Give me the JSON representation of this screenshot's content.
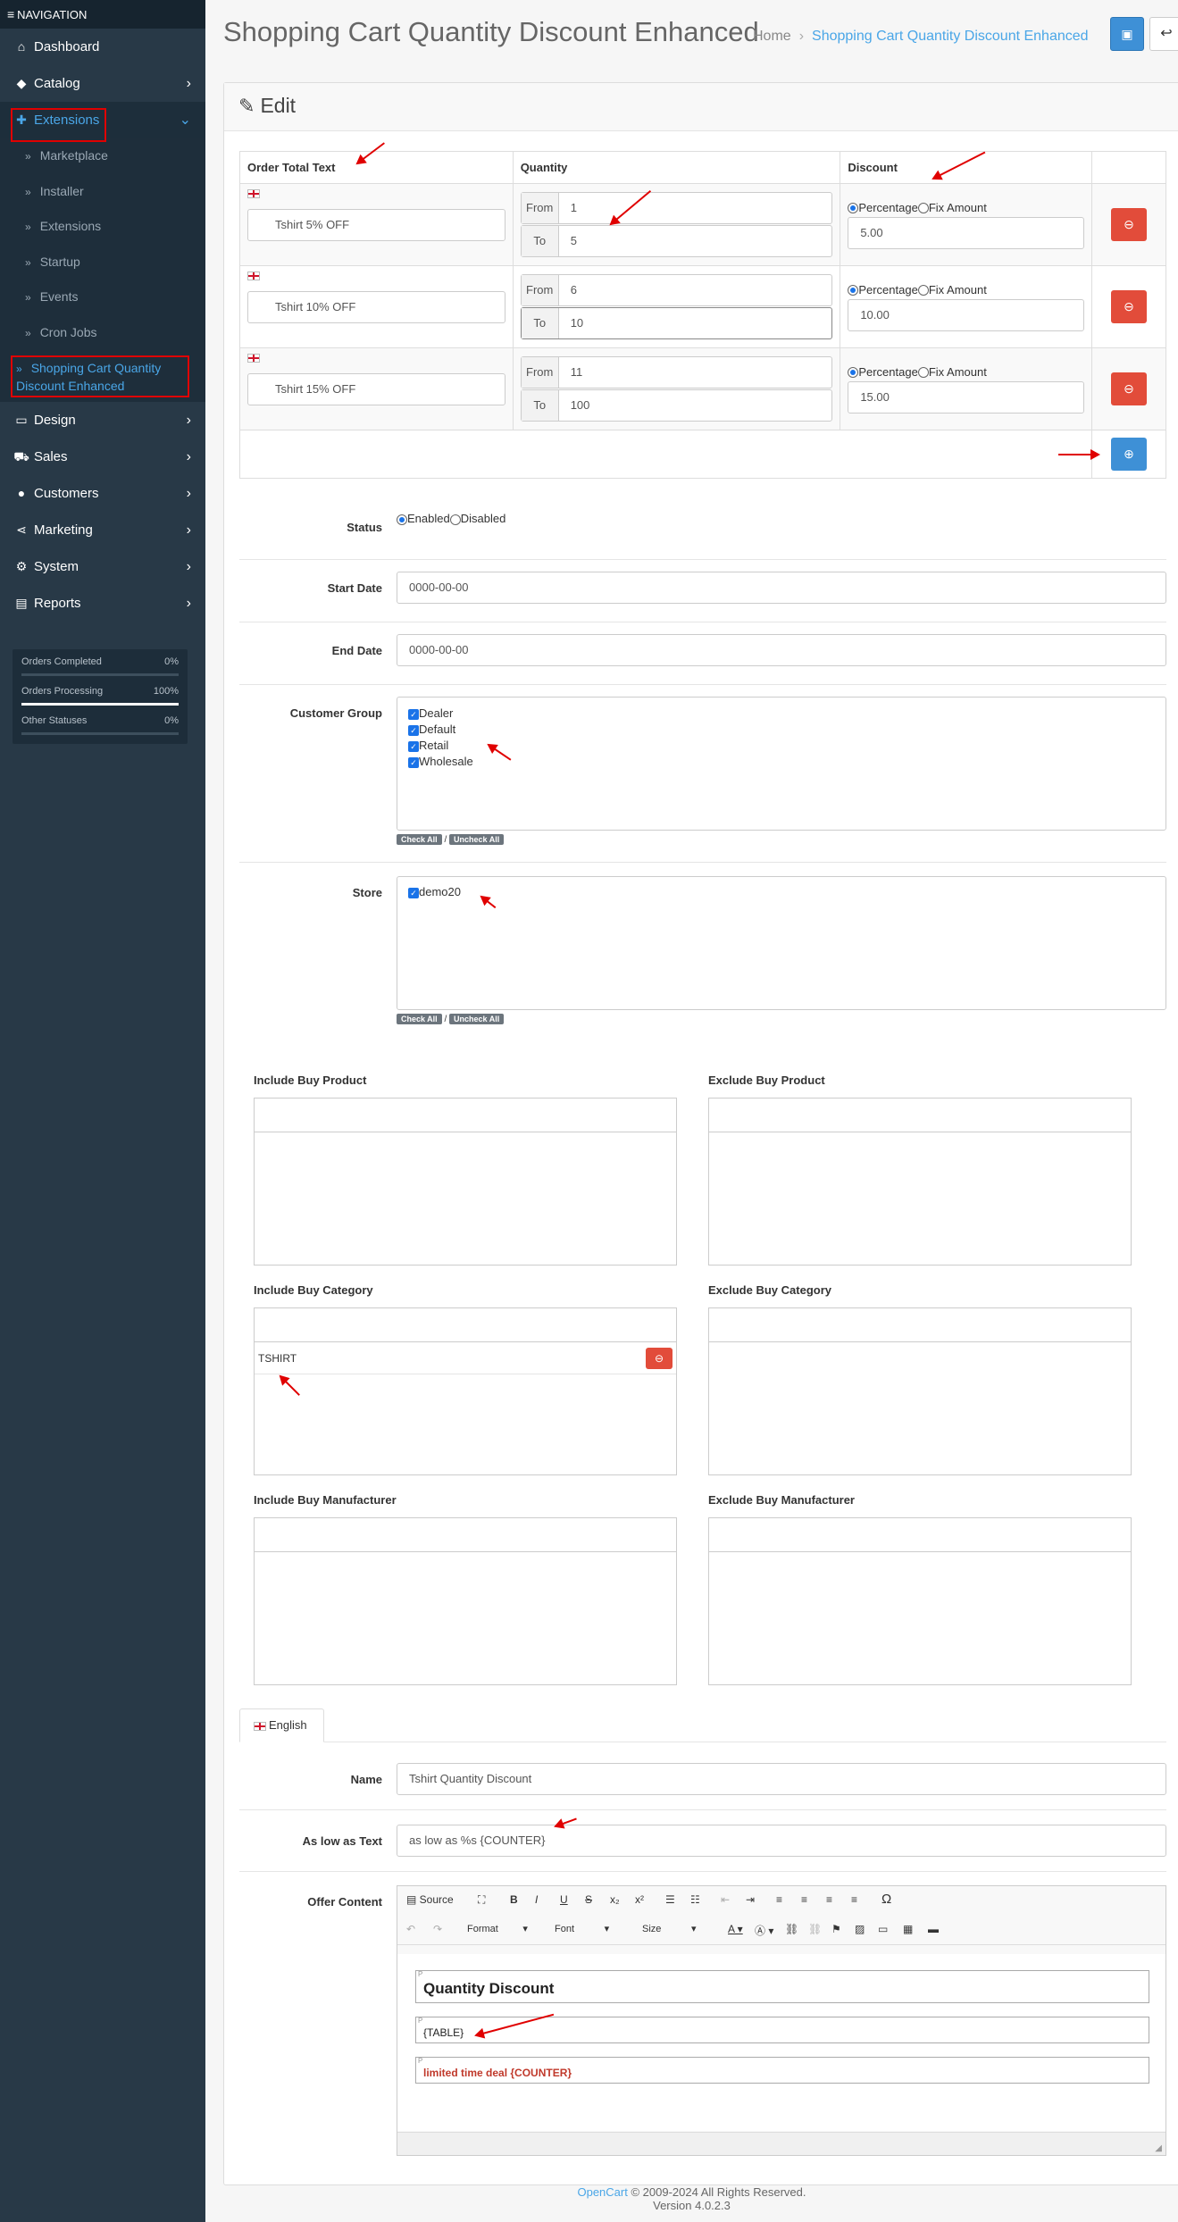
{
  "nav": {
    "header": "NAVIGATION",
    "items": [
      {
        "label": "Dashboard",
        "icon": "home-icon"
      },
      {
        "label": "Catalog",
        "icon": "tag-icon"
      },
      {
        "label": "Extensions",
        "icon": "puzzle-icon"
      }
    ],
    "sub_items": [
      "Marketplace",
      "Installer",
      "Extensions",
      "Startup",
      "Events",
      "Cron Jobs",
      "Shopping Cart Quantity Discount Enhanced"
    ],
    "items2": [
      {
        "label": "Design",
        "icon": "desktop-icon"
      },
      {
        "label": "Sales",
        "icon": "cart-icon"
      },
      {
        "label": "Customers",
        "icon": "user-icon"
      },
      {
        "label": "Marketing",
        "icon": "share-icon"
      },
      {
        "label": "System",
        "icon": "gear-icon"
      },
      {
        "label": "Reports",
        "icon": "chart-icon"
      }
    ],
    "stats": [
      {
        "label": "Orders Completed",
        "pct": "0%",
        "fill": 0
      },
      {
        "label": "Orders Processing",
        "pct": "100%",
        "fill": 1
      },
      {
        "label": "Other Statuses",
        "pct": "0%",
        "fill": 0
      }
    ]
  },
  "header": {
    "title": "Shopping Cart Quantity Discount Enhanced",
    "crumb_home": "Home",
    "crumb_current": "Shopping Cart Quantity Discount Enhanced"
  },
  "card": {
    "title": "Edit"
  },
  "table": {
    "headers": [
      "Order Total Text",
      "Quantity",
      "Discount"
    ],
    "from_label": "From",
    "to_label": "To",
    "pct_label": "Percentage",
    "fix_label": "Fix Amount",
    "rows": [
      {
        "text": "Tshirt 5% OFF",
        "from": "1",
        "to": "5",
        "discount": "5.00"
      },
      {
        "text": "Tshirt 10% OFF",
        "from": "6",
        "to": "10",
        "discount": "10.00"
      },
      {
        "text": "Tshirt 15% OFF",
        "from": "11",
        "to": "100",
        "discount": "15.00"
      }
    ]
  },
  "form": {
    "status_label": "Status",
    "enabled": "Enabled",
    "disabled": "Disabled",
    "start_label": "Start Date",
    "start_value": "0000-00-00",
    "end_label": "End Date",
    "end_value": "0000-00-00",
    "cg_label": "Customer Group",
    "groups": [
      "Dealer",
      "Default",
      "Retail",
      "Wholesale"
    ],
    "check_all": "Check All",
    "uncheck_all": "Uncheck All",
    "slash": "/",
    "store_label": "Store",
    "stores": [
      "demo20"
    ]
  },
  "filters": {
    "inc_product": "Include Buy Product",
    "exc_product": "Exclude Buy Product",
    "inc_category": "Include Buy Category",
    "exc_category": "Exclude Buy Category",
    "inc_manufacturer": "Include Buy Manufacturer",
    "exc_manufacturer": "Exclude Buy Manufacturer",
    "category_item": "TSHIRT"
  },
  "lang": {
    "tab": "English",
    "name_label": "Name",
    "name_value": "Tshirt Quantity Discount",
    "aslow_label": "As low as Text",
    "aslow_value": "as low as %s {COUNTER}",
    "offer_label": "Offer Content"
  },
  "editor": {
    "source": "Source",
    "format": "Format",
    "font": "Font",
    "size": "Size",
    "p": "P",
    "h": "Quantity Discount",
    "table": "{TABLE}",
    "deal": "limited time deal {COUNTER}"
  },
  "footer": {
    "link": "OpenCart",
    "copy": " © 2009-2024 All Rights Reserved.",
    "version": "Version 4.0.2.3"
  }
}
